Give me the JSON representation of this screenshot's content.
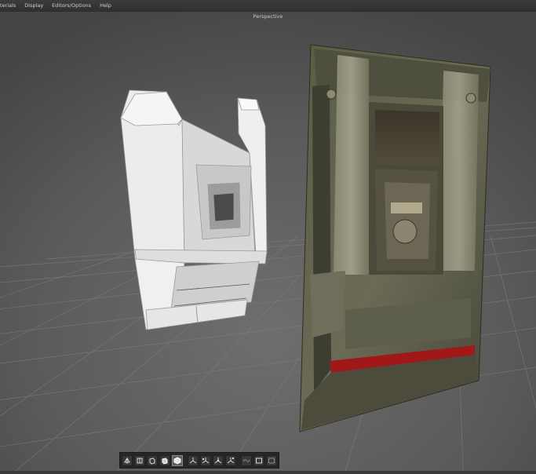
{
  "menubar": {
    "items": [
      {
        "label": "terials"
      },
      {
        "label": "Display"
      },
      {
        "label": "Editors/Options"
      },
      {
        "label": "Help"
      }
    ]
  },
  "viewport": {
    "title": "Perspective"
  },
  "toolbar": {
    "buttons": [
      {
        "icon": "cube-corner-icon"
      },
      {
        "icon": "cube-front-icon"
      },
      {
        "icon": "cube-side-icon"
      },
      {
        "icon": "cube-shaded-icon"
      },
      {
        "icon": "cube-solid-icon",
        "active": true
      },
      {
        "icon": "axis-icon"
      },
      {
        "icon": "rotate-axis-icon"
      },
      {
        "icon": "move-axis-icon"
      },
      {
        "icon": "scale-axis-icon"
      },
      {
        "icon": "wave-icon"
      },
      {
        "icon": "frame-icon"
      },
      {
        "icon": "dotted-frame-icon"
      }
    ]
  }
}
